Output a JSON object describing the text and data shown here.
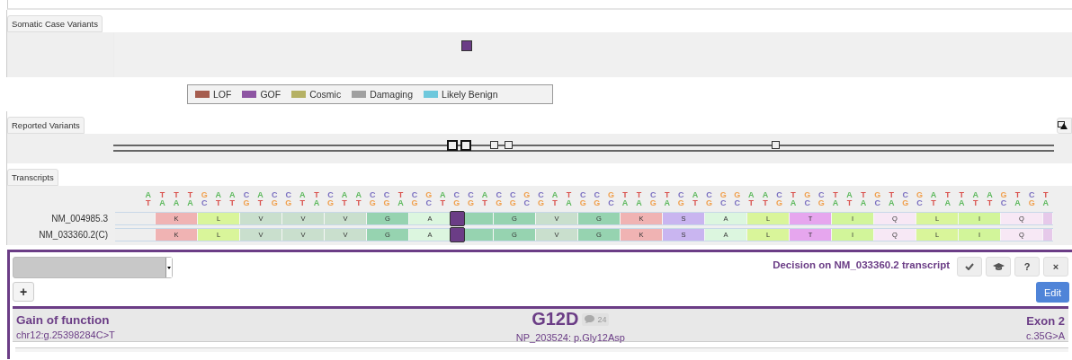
{
  "somatic_case_variants": {
    "tab": "Somatic Case Variants",
    "variants": [
      {
        "color": "#6b3d86"
      }
    ]
  },
  "legend": [
    {
      "label": "LOF",
      "color": "#a65d4f"
    },
    {
      "label": "GOF",
      "color": "#8e55a3"
    },
    {
      "label": "Cosmic",
      "color": "#b5b164"
    },
    {
      "label": "Damaging",
      "color": "#a0a0a0"
    },
    {
      "label": "Likely Benign",
      "color": "#6ec8dc"
    }
  ],
  "reported_variants": {
    "tab": "Reported Variants",
    "markers": [
      {
        "emphasized": true
      },
      {
        "emphasized": true
      },
      {
        "emphasized": false
      },
      {
        "emphasized": false
      },
      {
        "emphasized": false
      }
    ]
  },
  "transcripts": {
    "tab": "Transcripts",
    "forward_strand": [
      {
        "base": "A",
        "color": "#5cb85c"
      },
      {
        "base": "T",
        "color": "#d9534f"
      },
      {
        "base": "T",
        "color": "#d9534f"
      },
      {
        "base": "T",
        "color": "#d9534f"
      },
      {
        "base": "G",
        "color": "#f0a04e"
      },
      {
        "base": "A",
        "color": "#5cb85c"
      },
      {
        "base": "A",
        "color": "#5cb85c"
      },
      {
        "base": "C",
        "color": "#7a6fc0"
      },
      {
        "base": "A",
        "color": "#5cb85c"
      },
      {
        "base": "C",
        "color": "#7a6fc0"
      },
      {
        "base": "C",
        "color": "#7a6fc0"
      },
      {
        "base": "A",
        "color": "#5cb85c"
      },
      {
        "base": "T",
        "color": "#d9534f"
      },
      {
        "base": "C",
        "color": "#7a6fc0"
      },
      {
        "base": "A",
        "color": "#5cb85c"
      },
      {
        "base": "A",
        "color": "#5cb85c"
      },
      {
        "base": "C",
        "color": "#7a6fc0"
      },
      {
        "base": "C",
        "color": "#7a6fc0"
      },
      {
        "base": "T",
        "color": "#d9534f"
      },
      {
        "base": "C",
        "color": "#7a6fc0"
      },
      {
        "base": "G",
        "color": "#f0a04e"
      },
      {
        "base": "A",
        "color": "#5cb85c"
      },
      {
        "base": "C",
        "color": "#7a6fc0"
      },
      {
        "base": "C",
        "color": "#7a6fc0"
      },
      {
        "base": "A",
        "color": "#5cb85c"
      },
      {
        "base": "C",
        "color": "#7a6fc0"
      },
      {
        "base": "C",
        "color": "#7a6fc0"
      },
      {
        "base": "G",
        "color": "#f0a04e"
      },
      {
        "base": "C",
        "color": "#7a6fc0"
      },
      {
        "base": "A",
        "color": "#5cb85c"
      },
      {
        "base": "T",
        "color": "#d9534f"
      },
      {
        "base": "C",
        "color": "#7a6fc0"
      },
      {
        "base": "C",
        "color": "#7a6fc0"
      },
      {
        "base": "G",
        "color": "#f0a04e"
      },
      {
        "base": "T",
        "color": "#d9534f"
      },
      {
        "base": "T",
        "color": "#d9534f"
      },
      {
        "base": "C",
        "color": "#7a6fc0"
      },
      {
        "base": "T",
        "color": "#d9534f"
      },
      {
        "base": "C",
        "color": "#7a6fc0"
      },
      {
        "base": "A",
        "color": "#5cb85c"
      },
      {
        "base": "C",
        "color": "#7a6fc0"
      },
      {
        "base": "G",
        "color": "#f0a04e"
      },
      {
        "base": "G",
        "color": "#f0a04e"
      },
      {
        "base": "A",
        "color": "#5cb85c"
      },
      {
        "base": "A",
        "color": "#5cb85c"
      },
      {
        "base": "C",
        "color": "#7a6fc0"
      },
      {
        "base": "T",
        "color": "#d9534f"
      },
      {
        "base": "G",
        "color": "#f0a04e"
      },
      {
        "base": "C",
        "color": "#7a6fc0"
      },
      {
        "base": "T",
        "color": "#d9534f"
      },
      {
        "base": "A",
        "color": "#5cb85c"
      },
      {
        "base": "T",
        "color": "#d9534f"
      },
      {
        "base": "G",
        "color": "#f0a04e"
      },
      {
        "base": "T",
        "color": "#d9534f"
      },
      {
        "base": "C",
        "color": "#7a6fc0"
      },
      {
        "base": "G",
        "color": "#f0a04e"
      },
      {
        "base": "A",
        "color": "#5cb85c"
      },
      {
        "base": "T",
        "color": "#d9534f"
      },
      {
        "base": "T",
        "color": "#d9534f"
      },
      {
        "base": "A",
        "color": "#5cb85c"
      },
      {
        "base": "A",
        "color": "#5cb85c"
      },
      {
        "base": "G",
        "color": "#f0a04e"
      },
      {
        "base": "T",
        "color": "#d9534f"
      },
      {
        "base": "C",
        "color": "#7a6fc0"
      },
      {
        "base": "T",
        "color": "#d9534f"
      }
    ],
    "reverse_strand": [
      {
        "base": "T",
        "color": "#d9534f"
      },
      {
        "base": "A",
        "color": "#5cb85c"
      },
      {
        "base": "A",
        "color": "#5cb85c"
      },
      {
        "base": "A",
        "color": "#5cb85c"
      },
      {
        "base": "C",
        "color": "#7a6fc0"
      },
      {
        "base": "T",
        "color": "#d9534f"
      },
      {
        "base": "T",
        "color": "#d9534f"
      },
      {
        "base": "G",
        "color": "#f0a04e"
      },
      {
        "base": "T",
        "color": "#d9534f"
      },
      {
        "base": "G",
        "color": "#f0a04e"
      },
      {
        "base": "G",
        "color": "#f0a04e"
      },
      {
        "base": "T",
        "color": "#d9534f"
      },
      {
        "base": "A",
        "color": "#5cb85c"
      },
      {
        "base": "G",
        "color": "#f0a04e"
      },
      {
        "base": "T",
        "color": "#d9534f"
      },
      {
        "base": "T",
        "color": "#d9534f"
      },
      {
        "base": "G",
        "color": "#f0a04e"
      },
      {
        "base": "G",
        "color": "#f0a04e"
      },
      {
        "base": "A",
        "color": "#5cb85c"
      },
      {
        "base": "G",
        "color": "#f0a04e"
      },
      {
        "base": "C",
        "color": "#7a6fc0"
      },
      {
        "base": "T",
        "color": "#d9534f"
      },
      {
        "base": "G",
        "color": "#f0a04e"
      },
      {
        "base": "G",
        "color": "#f0a04e"
      },
      {
        "base": "T",
        "color": "#d9534f"
      },
      {
        "base": "G",
        "color": "#f0a04e"
      },
      {
        "base": "G",
        "color": "#f0a04e"
      },
      {
        "base": "C",
        "color": "#7a6fc0"
      },
      {
        "base": "G",
        "color": "#f0a04e"
      },
      {
        "base": "T",
        "color": "#d9534f"
      },
      {
        "base": "A",
        "color": "#5cb85c"
      },
      {
        "base": "G",
        "color": "#f0a04e"
      },
      {
        "base": "G",
        "color": "#f0a04e"
      },
      {
        "base": "C",
        "color": "#7a6fc0"
      },
      {
        "base": "A",
        "color": "#5cb85c"
      },
      {
        "base": "A",
        "color": "#5cb85c"
      },
      {
        "base": "G",
        "color": "#f0a04e"
      },
      {
        "base": "A",
        "color": "#5cb85c"
      },
      {
        "base": "G",
        "color": "#f0a04e"
      },
      {
        "base": "T",
        "color": "#d9534f"
      },
      {
        "base": "G",
        "color": "#f0a04e"
      },
      {
        "base": "C",
        "color": "#7a6fc0"
      },
      {
        "base": "C",
        "color": "#7a6fc0"
      },
      {
        "base": "T",
        "color": "#d9534f"
      },
      {
        "base": "T",
        "color": "#d9534f"
      },
      {
        "base": "G",
        "color": "#f0a04e"
      },
      {
        "base": "A",
        "color": "#5cb85c"
      },
      {
        "base": "C",
        "color": "#7a6fc0"
      },
      {
        "base": "G",
        "color": "#f0a04e"
      },
      {
        "base": "A",
        "color": "#5cb85c"
      },
      {
        "base": "T",
        "color": "#d9534f"
      },
      {
        "base": "A",
        "color": "#5cb85c"
      },
      {
        "base": "C",
        "color": "#7a6fc0"
      },
      {
        "base": "A",
        "color": "#5cb85c"
      },
      {
        "base": "G",
        "color": "#f0a04e"
      },
      {
        "base": "C",
        "color": "#7a6fc0"
      },
      {
        "base": "T",
        "color": "#d9534f"
      },
      {
        "base": "A",
        "color": "#5cb85c"
      },
      {
        "base": "A",
        "color": "#5cb85c"
      },
      {
        "base": "T",
        "color": "#d9534f"
      },
      {
        "base": "T",
        "color": "#d9534f"
      },
      {
        "base": "C",
        "color": "#7a6fc0"
      },
      {
        "base": "A",
        "color": "#5cb85c"
      },
      {
        "base": "G",
        "color": "#f0a04e"
      },
      {
        "base": "A",
        "color": "#5cb85c"
      }
    ],
    "rows": [
      {
        "name": "NM_004985.3",
        "codons": [
          {
            "kind": "blank",
            "color": "#eeeeee",
            "selected": false
          },
          {
            "kind": "codon",
            "aa": "K",
            "color": "#f0b3b3",
            "selected": false
          },
          {
            "kind": "codon",
            "aa": "L",
            "color": "#d9f59a",
            "selected": false
          },
          {
            "kind": "codon",
            "aa": "V",
            "color": "#c9dfcd",
            "selected": false
          },
          {
            "kind": "codon",
            "aa": "V",
            "color": "#c9dfcd",
            "selected": false
          },
          {
            "kind": "codon",
            "aa": "V",
            "color": "#c9dfcd",
            "selected": false
          },
          {
            "kind": "codon",
            "aa": "G",
            "color": "#96d3b0",
            "selected": false
          },
          {
            "kind": "codon",
            "aa": "A",
            "color": "#dcf6df",
            "selected": false
          },
          {
            "kind": "codon",
            "color": "#96d3b0",
            "selected": true
          },
          {
            "kind": "codon",
            "aa": "G",
            "color": "#96d3b0",
            "selected": false
          },
          {
            "kind": "codon",
            "aa": "V",
            "color": "#c9dfcd",
            "selected": false
          },
          {
            "kind": "codon",
            "aa": "G",
            "color": "#96d3b0",
            "selected": false
          },
          {
            "kind": "codon",
            "aa": "K",
            "color": "#f0b3b3",
            "selected": false
          },
          {
            "kind": "codon",
            "aa": "S",
            "color": "#c9b5f0",
            "selected": false
          },
          {
            "kind": "codon",
            "aa": "A",
            "color": "#dcf6df",
            "selected": false
          },
          {
            "kind": "codon",
            "aa": "L",
            "color": "#d9f59a",
            "selected": false
          },
          {
            "kind": "codon",
            "aa": "T",
            "color": "#e6a6ee",
            "selected": false
          },
          {
            "kind": "codon",
            "aa": "I",
            "color": "#d2f59a",
            "selected": false
          },
          {
            "kind": "codon",
            "aa": "Q",
            "color": "#f7e8f5",
            "selected": false
          },
          {
            "kind": "codon",
            "aa": "L",
            "color": "#d9f59a",
            "selected": false
          },
          {
            "kind": "codon",
            "aa": "I",
            "color": "#d2f59a",
            "selected": false
          },
          {
            "kind": "codon",
            "aa": "Q",
            "color": "#f7e8f5",
            "selected": false
          },
          {
            "kind": "partial",
            "color": "#e6c9ea",
            "selected": false
          }
        ]
      },
      {
        "name": "NM_033360.2(C)",
        "codons": [
          {
            "kind": "blank",
            "color": "#eeeeee",
            "selected": false
          },
          {
            "kind": "codon",
            "aa": "K",
            "color": "#f0b3b3",
            "selected": false
          },
          {
            "kind": "codon",
            "aa": "L",
            "color": "#d9f59a",
            "selected": false
          },
          {
            "kind": "codon",
            "aa": "V",
            "color": "#c9dfcd",
            "selected": false
          },
          {
            "kind": "codon",
            "aa": "V",
            "color": "#c9dfcd",
            "selected": false
          },
          {
            "kind": "codon",
            "aa": "V",
            "color": "#c9dfcd",
            "selected": false
          },
          {
            "kind": "codon",
            "aa": "G",
            "color": "#96d3b0",
            "selected": false
          },
          {
            "kind": "codon",
            "aa": "A",
            "color": "#dcf6df",
            "selected": false
          },
          {
            "kind": "codon",
            "color": "#96d3b0",
            "selected": true
          },
          {
            "kind": "codon",
            "aa": "G",
            "color": "#96d3b0",
            "selected": false
          },
          {
            "kind": "codon",
            "aa": "V",
            "color": "#c9dfcd",
            "selected": false
          },
          {
            "kind": "codon",
            "aa": "G",
            "color": "#96d3b0",
            "selected": false
          },
          {
            "kind": "codon",
            "aa": "K",
            "color": "#f0b3b3",
            "selected": false
          },
          {
            "kind": "codon",
            "aa": "S",
            "color": "#c9b5f0",
            "selected": false
          },
          {
            "kind": "codon",
            "aa": "A",
            "color": "#dcf6df",
            "selected": false
          },
          {
            "kind": "codon",
            "aa": "L",
            "color": "#d9f59a",
            "selected": false
          },
          {
            "kind": "codon",
            "aa": "T",
            "color": "#e6a6ee",
            "selected": false
          },
          {
            "kind": "codon",
            "aa": "I",
            "color": "#d2f59a",
            "selected": false
          },
          {
            "kind": "codon",
            "aa": "Q",
            "color": "#f7e8f5",
            "selected": false
          },
          {
            "kind": "codon",
            "aa": "L",
            "color": "#d9f59a",
            "selected": false
          },
          {
            "kind": "codon",
            "aa": "I",
            "color": "#d2f59a",
            "selected": false
          },
          {
            "kind": "codon",
            "aa": "Q",
            "color": "#f7e8f5",
            "selected": false
          },
          {
            "kind": "partial",
            "color": "#e6c9ea",
            "selected": false
          }
        ]
      }
    ]
  },
  "decision": {
    "add_button": "+",
    "title": "Decision on NM_033360.2 transcript",
    "buttons": [
      {
        "kind": "check"
      },
      {
        "kind": "cap"
      },
      {
        "kind": "text",
        "label": "?"
      },
      {
        "kind": "text",
        "label": "×"
      }
    ],
    "edit_button": "Edit"
  },
  "variant": {
    "effect": "Gain of function",
    "genomic": "chr12:g.25398284C>T",
    "protein_change": "G12D",
    "comments": "24",
    "protein": "NP_203524: p.Gly12Asp",
    "exon": "Exon 2",
    "cdna": "c.35G>A"
  }
}
